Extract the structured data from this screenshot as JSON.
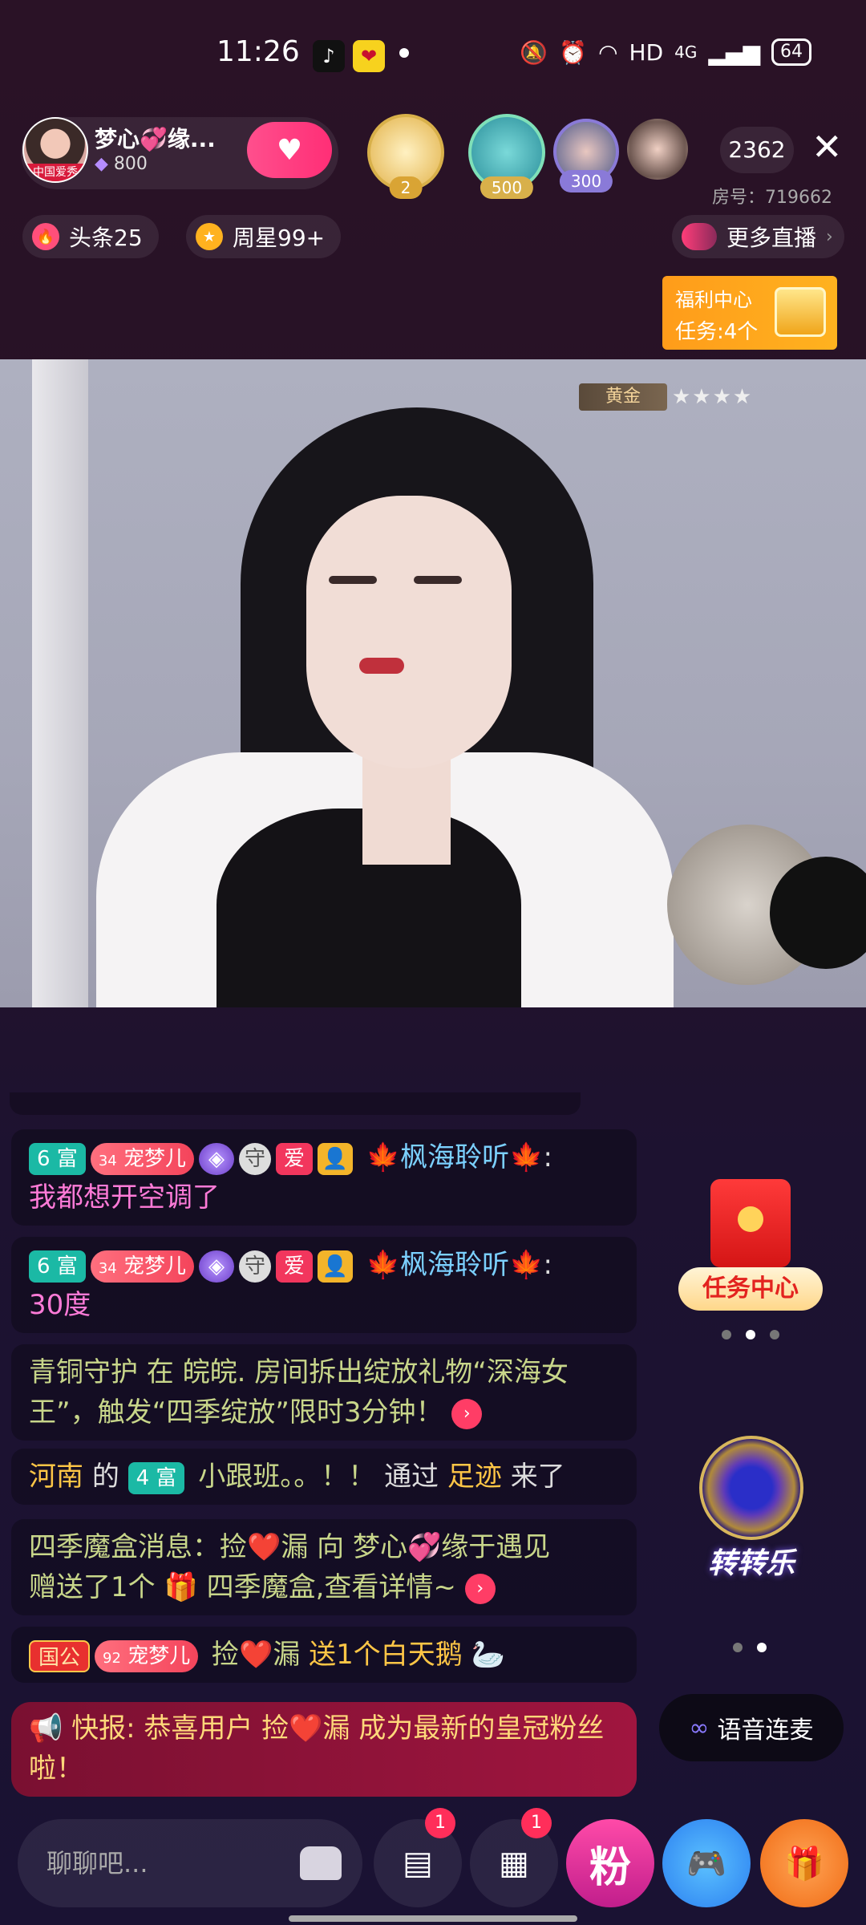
{
  "status_bar": {
    "time": "11:26",
    "network": "HD",
    "signal": "4G",
    "battery": "64"
  },
  "anchor": {
    "name": "梦心💞缘...",
    "avatar_tag": "中国爱秀",
    "count": "800"
  },
  "viewers": [
    {
      "badge": "2",
      "badge_color": "#d9a434"
    },
    {
      "badge": "500",
      "badge_color": "#d8b04a"
    },
    {
      "badge": "300",
      "badge_color": "#8a7ad8"
    },
    {
      "badge": "",
      "badge_color": ""
    }
  ],
  "online_count": "2362",
  "room_number": "房号：719662",
  "pills": {
    "headline": "头条25",
    "weekly_star": "周星99+",
    "more_live": "更多直播"
  },
  "welfare": {
    "title": "福利中心",
    "tasks": "任务:4个"
  },
  "video": {
    "rank": "黄金",
    "stars": "★★★★"
  },
  "chat": {
    "msg1": {
      "rich": "6 富",
      "pet_level": "34",
      "pet": "宠梦儿",
      "guard": "守",
      "love": "爱",
      "user": "枫海聆听",
      "colon": ":",
      "text": "我都想开空调了"
    },
    "msg2": {
      "rich": "6 富",
      "pet_level": "34",
      "pet": "宠梦儿",
      "guard": "守",
      "love": "爱",
      "user": "枫海聆听",
      "colon": ":",
      "text": "30度"
    },
    "msg3": {
      "text": "青铜守护 在 皖皖. 房间拆出绽放礼物“深海女王”，触发“四季绽放”限时3分钟！"
    },
    "msg4": {
      "place": "河南",
      "of": "的",
      "rich": "4 富",
      "user": "小跟班。。！！",
      "via": "通过",
      "vehicle": "足迹",
      "arrive": "来了"
    },
    "msg5": {
      "text1": "四季魔盒消息：捡❤️漏 向 梦心💞缘于遇见",
      "text2": "赠送了1个",
      "text3": "四季魔盒,查看详情~"
    },
    "msg6": {
      "country": "国公",
      "pet_level": "92",
      "pet": "宠梦儿",
      "user": "捡❤️漏",
      "gift": "送1个白天鹅"
    },
    "flash": "📢 快报: 恭喜用户 捡❤️漏 成为最新的皇冠粉丝啦！"
  },
  "side": {
    "task_center": "任务中心",
    "spin": "转转乐",
    "voice": "语音连麦"
  },
  "bottom": {
    "placeholder": "聊聊吧...",
    "msg_badge": "1",
    "apps_badge": "1",
    "fan": "粉"
  }
}
